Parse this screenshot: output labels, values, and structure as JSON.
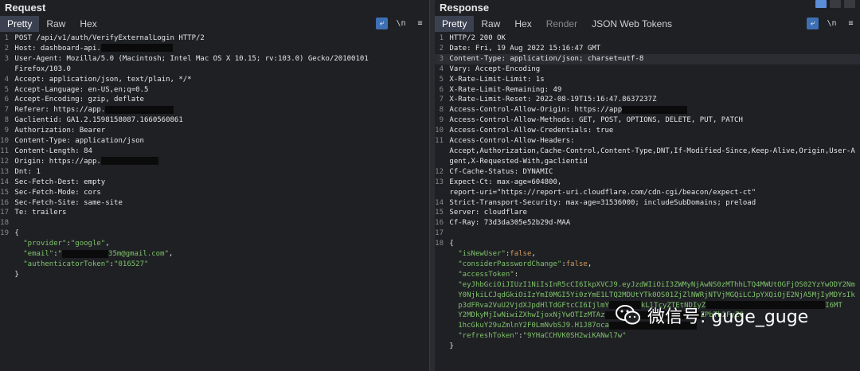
{
  "request": {
    "title": "Request",
    "tabs": [
      "Pretty",
      "Raw",
      "Hex"
    ],
    "active_tab": 0,
    "icons": [
      "wrap-icon",
      "newline-icon",
      "menu-icon"
    ],
    "icon_glyphs": [
      "⤶",
      "\\n",
      "≡"
    ],
    "lines": [
      {
        "n": "1",
        "parts": [
          [
            "k",
            "POST /api/v1/auth/VerifyExternalLogin HTTP/2"
          ]
        ]
      },
      {
        "n": "2",
        "parts": [
          [
            "k",
            "Host: dashboard-api."
          ],
          [
            "r",
            "90"
          ]
        ]
      },
      {
        "n": "3",
        "parts": [
          [
            "k",
            "User-Agent: Mozilla/5.0 (Macintosh; Intel Mac OS X 10.15; rv:103.0) Gecko/20100101"
          ]
        ]
      },
      {
        "n": "",
        "parts": [
          [
            "k",
            "Firefox/103.0"
          ]
        ]
      },
      {
        "n": "4",
        "parts": [
          [
            "k",
            "Accept: application/json, text/plain, */*"
          ]
        ]
      },
      {
        "n": "5",
        "parts": [
          [
            "k",
            "Accept-Language: en-US,en;q=0.5"
          ]
        ]
      },
      {
        "n": "6",
        "parts": [
          [
            "k",
            "Accept-Encoding: gzip, deflate"
          ]
        ]
      },
      {
        "n": "7",
        "parts": [
          [
            "k",
            "Referer: https://app."
          ],
          [
            "r",
            "86"
          ]
        ]
      },
      {
        "n": "8",
        "parts": [
          [
            "k",
            "Gaclientid: GA1.2.1598158087.1660560861"
          ]
        ]
      },
      {
        "n": "9",
        "parts": [
          [
            "k",
            "Authorization: Bearer"
          ]
        ]
      },
      {
        "n": "10",
        "parts": [
          [
            "k",
            "Content-Type: application/json"
          ]
        ]
      },
      {
        "n": "11",
        "parts": [
          [
            "k",
            "Content-Length: 84"
          ]
        ]
      },
      {
        "n": "12",
        "parts": [
          [
            "k",
            "Origin: https://app."
          ],
          [
            "r",
            "72"
          ]
        ]
      },
      {
        "n": "13",
        "parts": [
          [
            "k",
            "Dnt: 1"
          ]
        ]
      },
      {
        "n": "14",
        "parts": [
          [
            "k",
            "Sec-Fetch-Dest: empty"
          ]
        ]
      },
      {
        "n": "15",
        "parts": [
          [
            "k",
            "Sec-Fetch-Mode: cors"
          ]
        ]
      },
      {
        "n": "16",
        "parts": [
          [
            "k",
            "Sec-Fetch-Site: same-site"
          ]
        ]
      },
      {
        "n": "17",
        "parts": [
          [
            "k",
            "Te: trailers"
          ]
        ]
      },
      {
        "n": "18",
        "parts": []
      },
      {
        "n": "19",
        "parts": [
          [
            "k",
            "{"
          ]
        ]
      },
      {
        "n": "",
        "parts": [
          [
            "k",
            "  "
          ],
          [
            "s",
            "\"provider\""
          ],
          [
            "k",
            ":"
          ],
          [
            "s",
            "\"google\""
          ],
          [
            "k",
            ","
          ]
        ]
      },
      {
        "n": "",
        "parts": [
          [
            "k",
            "  "
          ],
          [
            "s",
            "\"email\""
          ],
          [
            "k",
            ":"
          ],
          [
            "s",
            "\""
          ],
          [
            "r",
            "58"
          ],
          [
            "s",
            "35m@gmail.com\""
          ],
          [
            "k",
            ","
          ]
        ]
      },
      {
        "n": "",
        "parts": [
          [
            "k",
            "  "
          ],
          [
            "s",
            "\"authenticatorToken\""
          ],
          [
            "k",
            ":"
          ],
          [
            "s",
            "\"016527\""
          ]
        ]
      },
      {
        "n": "",
        "parts": [
          [
            "k",
            "}"
          ]
        ]
      }
    ]
  },
  "response": {
    "title": "Response",
    "tabs": [
      "Pretty",
      "Raw",
      "Hex",
      "Render",
      "JSON Web Tokens"
    ],
    "active_tab": 0,
    "dim_tabs": [
      3
    ],
    "icons": [
      "wrap-icon",
      "newline-icon",
      "menu-icon"
    ],
    "icon_glyphs": [
      "⤶",
      "\\n",
      "≡"
    ],
    "lines": [
      {
        "n": "1",
        "parts": [
          [
            "k",
            "HTTP/2 200 OK"
          ]
        ]
      },
      {
        "n": "2",
        "parts": [
          [
            "k",
            "Date: Fri, 19 Aug 2022 15:16:47 GMT"
          ]
        ]
      },
      {
        "n": "3",
        "parts": [
          [
            "k",
            "Content-Type: application/json; charset=utf-8"
          ]
        ],
        "hl": true
      },
      {
        "n": "4",
        "parts": [
          [
            "k",
            "Vary: Accept-Encoding"
          ]
        ]
      },
      {
        "n": "5",
        "parts": [
          [
            "k",
            "X-Rate-Limit-Limit: 1s"
          ]
        ]
      },
      {
        "n": "6",
        "parts": [
          [
            "k",
            "X-Rate-Limit-Remaining: 49"
          ]
        ]
      },
      {
        "n": "7",
        "parts": [
          [
            "k",
            "X-Rate-Limit-Reset: 2022-08-19T15:16:47.8637237Z"
          ]
        ]
      },
      {
        "n": "8",
        "parts": [
          [
            "k",
            "Access-Control-Allow-Origin: https://app"
          ],
          [
            "r",
            "82"
          ]
        ]
      },
      {
        "n": "9",
        "parts": [
          [
            "k",
            "Access-Control-Allow-Methods: GET, POST, OPTIONS, DELETE, PUT, PATCH"
          ]
        ]
      },
      {
        "n": "10",
        "parts": [
          [
            "k",
            "Access-Control-Allow-Credentials: true"
          ]
        ]
      },
      {
        "n": "11",
        "parts": [
          [
            "k",
            "Access-Control-Allow-Headers:"
          ]
        ]
      },
      {
        "n": "",
        "parts": [
          [
            "k",
            "Accept,Authorization,Cache-Control,Content-Type,DNT,If-Modified-Since,Keep-Alive,Origin,User-A"
          ]
        ]
      },
      {
        "n": "",
        "parts": [
          [
            "k",
            "gent,X-Requested-With,gaclientid"
          ]
        ]
      },
      {
        "n": "12",
        "parts": [
          [
            "k",
            "Cf-Cache-Status: DYNAMIC"
          ]
        ]
      },
      {
        "n": "13",
        "parts": [
          [
            "k",
            "Expect-Ct: max-age=604800,"
          ]
        ]
      },
      {
        "n": "",
        "parts": [
          [
            "k",
            "report-uri=\"https://report-uri.cloudflare.com/cdn-cgi/beacon/expect-ct\""
          ]
        ]
      },
      {
        "n": "14",
        "parts": [
          [
            "k",
            "Strict-Transport-Security: max-age=31536000; includeSubDomains; preload"
          ]
        ]
      },
      {
        "n": "15",
        "parts": [
          [
            "k",
            "Server: cloudflare"
          ]
        ]
      },
      {
        "n": "16",
        "parts": [
          [
            "k",
            "Cf-Ray: 73d3da305e52b29d-MAA"
          ]
        ]
      },
      {
        "n": "17",
        "parts": []
      },
      {
        "n": "18",
        "parts": [
          [
            "k",
            "{"
          ]
        ]
      },
      {
        "n": "",
        "parts": [
          [
            "k",
            "  "
          ],
          [
            "s",
            "\"isNewUser\""
          ],
          [
            "k",
            ":"
          ],
          [
            "kw",
            "false"
          ],
          [
            "k",
            ","
          ]
        ]
      },
      {
        "n": "",
        "parts": [
          [
            "k",
            "  "
          ],
          [
            "s",
            "\"considerPasswordChange\""
          ],
          [
            "k",
            ":"
          ],
          [
            "kw",
            "false"
          ],
          [
            "k",
            ","
          ]
        ]
      },
      {
        "n": "",
        "parts": [
          [
            "k",
            "  "
          ],
          [
            "s",
            "\"accessToken\""
          ],
          [
            "k",
            ":"
          ]
        ]
      },
      {
        "n": "",
        "parts": [
          [
            "k",
            "  "
          ],
          [
            "s",
            "\"eyJhbGciOiJIUzI1NiIsInR5cCI6IkpXVCJ9.eyJzdWIiOiI3ZWMyNjAwNS0zMThhLTQ4MWUtOGFjOS02YzYwODY2Nm"
          ]
        ]
      },
      {
        "n": "",
        "parts": [
          [
            "k",
            "  "
          ],
          [
            "s",
            "Y0NjkiLCJqdGkiOiIzYmI0MGI5Yi0zYmE1LTQ2MDUtYTk0OS01ZjZlNWRjNTVjMGQiLCJpYXQiOjE2NjA5MjIyMDYsIk"
          ]
        ]
      },
      {
        "n": "",
        "parts": [
          [
            "k",
            "  "
          ],
          [
            "s",
            "p3dFRva2VuU2VjdXJpdHlTdGFtcCI6IjlmY"
          ],
          [
            "r",
            "40"
          ],
          [
            "s",
            "kLlTcyZTEtNDIyZ"
          ],
          [
            "r",
            "150"
          ],
          [
            "s",
            "I6MT"
          ]
        ]
      },
      {
        "n": "",
        "parts": [
          [
            "k",
            "  "
          ],
          [
            "s",
            "Y2MDkyMjIwNiwiZXhwIjoxNjYwOTIzMTAz"
          ],
          [
            "r",
            "120"
          ],
          [
            "s",
            "ZPbTb2FyZC"
          ]
        ]
      },
      {
        "n": "",
        "parts": [
          [
            "k",
            "  "
          ],
          [
            "s",
            "1hcGkuY29uZmlnY2F0LmNvbSJ9.H1J87oca"
          ],
          [
            "r",
            "110"
          ]
        ]
      },
      {
        "n": "",
        "parts": [
          [
            "k",
            "  "
          ],
          [
            "s",
            "\"refreshToken\""
          ],
          [
            "k",
            ":"
          ],
          [
            "s",
            "\"9YHaCCHVK0SH2wiKANwl7w\""
          ]
        ]
      },
      {
        "n": "",
        "parts": [
          [
            "k",
            "}"
          ]
        ]
      }
    ]
  },
  "watermark": {
    "text": "微信号: guge_guge"
  },
  "colors": {
    "active_tab_bg": "#3b4150",
    "string_green": "#7fc36a",
    "keyword_orange": "#d29a5a",
    "icon_blue": "#3d6fb5"
  }
}
